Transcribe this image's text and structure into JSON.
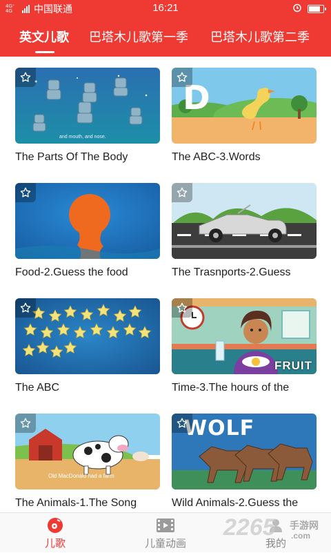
{
  "status_bar": {
    "signal_label": "4G⁺ 4G",
    "carrier": "中国联通",
    "time": "16:21"
  },
  "tabs": [
    {
      "label": "英文儿歌",
      "active": true
    },
    {
      "label": "巴塔木儿歌第一季",
      "active": false
    },
    {
      "label": "巴塔木儿歌第二季",
      "active": false
    }
  ],
  "videos": [
    {
      "title": "The Parts Of The Body",
      "caption": "and mouth, and nose."
    },
    {
      "title": "The ABC-3.Words",
      "letter": "D"
    },
    {
      "title": "Food-2.Guess the food"
    },
    {
      "title": "The Trasnports-2.Guess"
    },
    {
      "title": "The ABC"
    },
    {
      "title": "Time-3.The hours of the",
      "word": "FRUIT"
    },
    {
      "title": "The Animals-1.The Song",
      "caption": "Old MacDonald had a farm"
    },
    {
      "title": "Wild Animals-2.Guess the",
      "word": "WOLF"
    }
  ],
  "bottom_nav": [
    {
      "label": "儿歌",
      "active": true,
      "icon": "music-disc-icon"
    },
    {
      "label": "儿童动画",
      "active": false,
      "icon": "film-icon"
    },
    {
      "label": "我的",
      "active": false,
      "icon": "profile-icon"
    }
  ],
  "watermark": {
    "number": "2265",
    "suffix": "手游网",
    "domain": ".com"
  },
  "colors": {
    "accent": "#ee3a33",
    "nav_inactive": "#888888"
  }
}
